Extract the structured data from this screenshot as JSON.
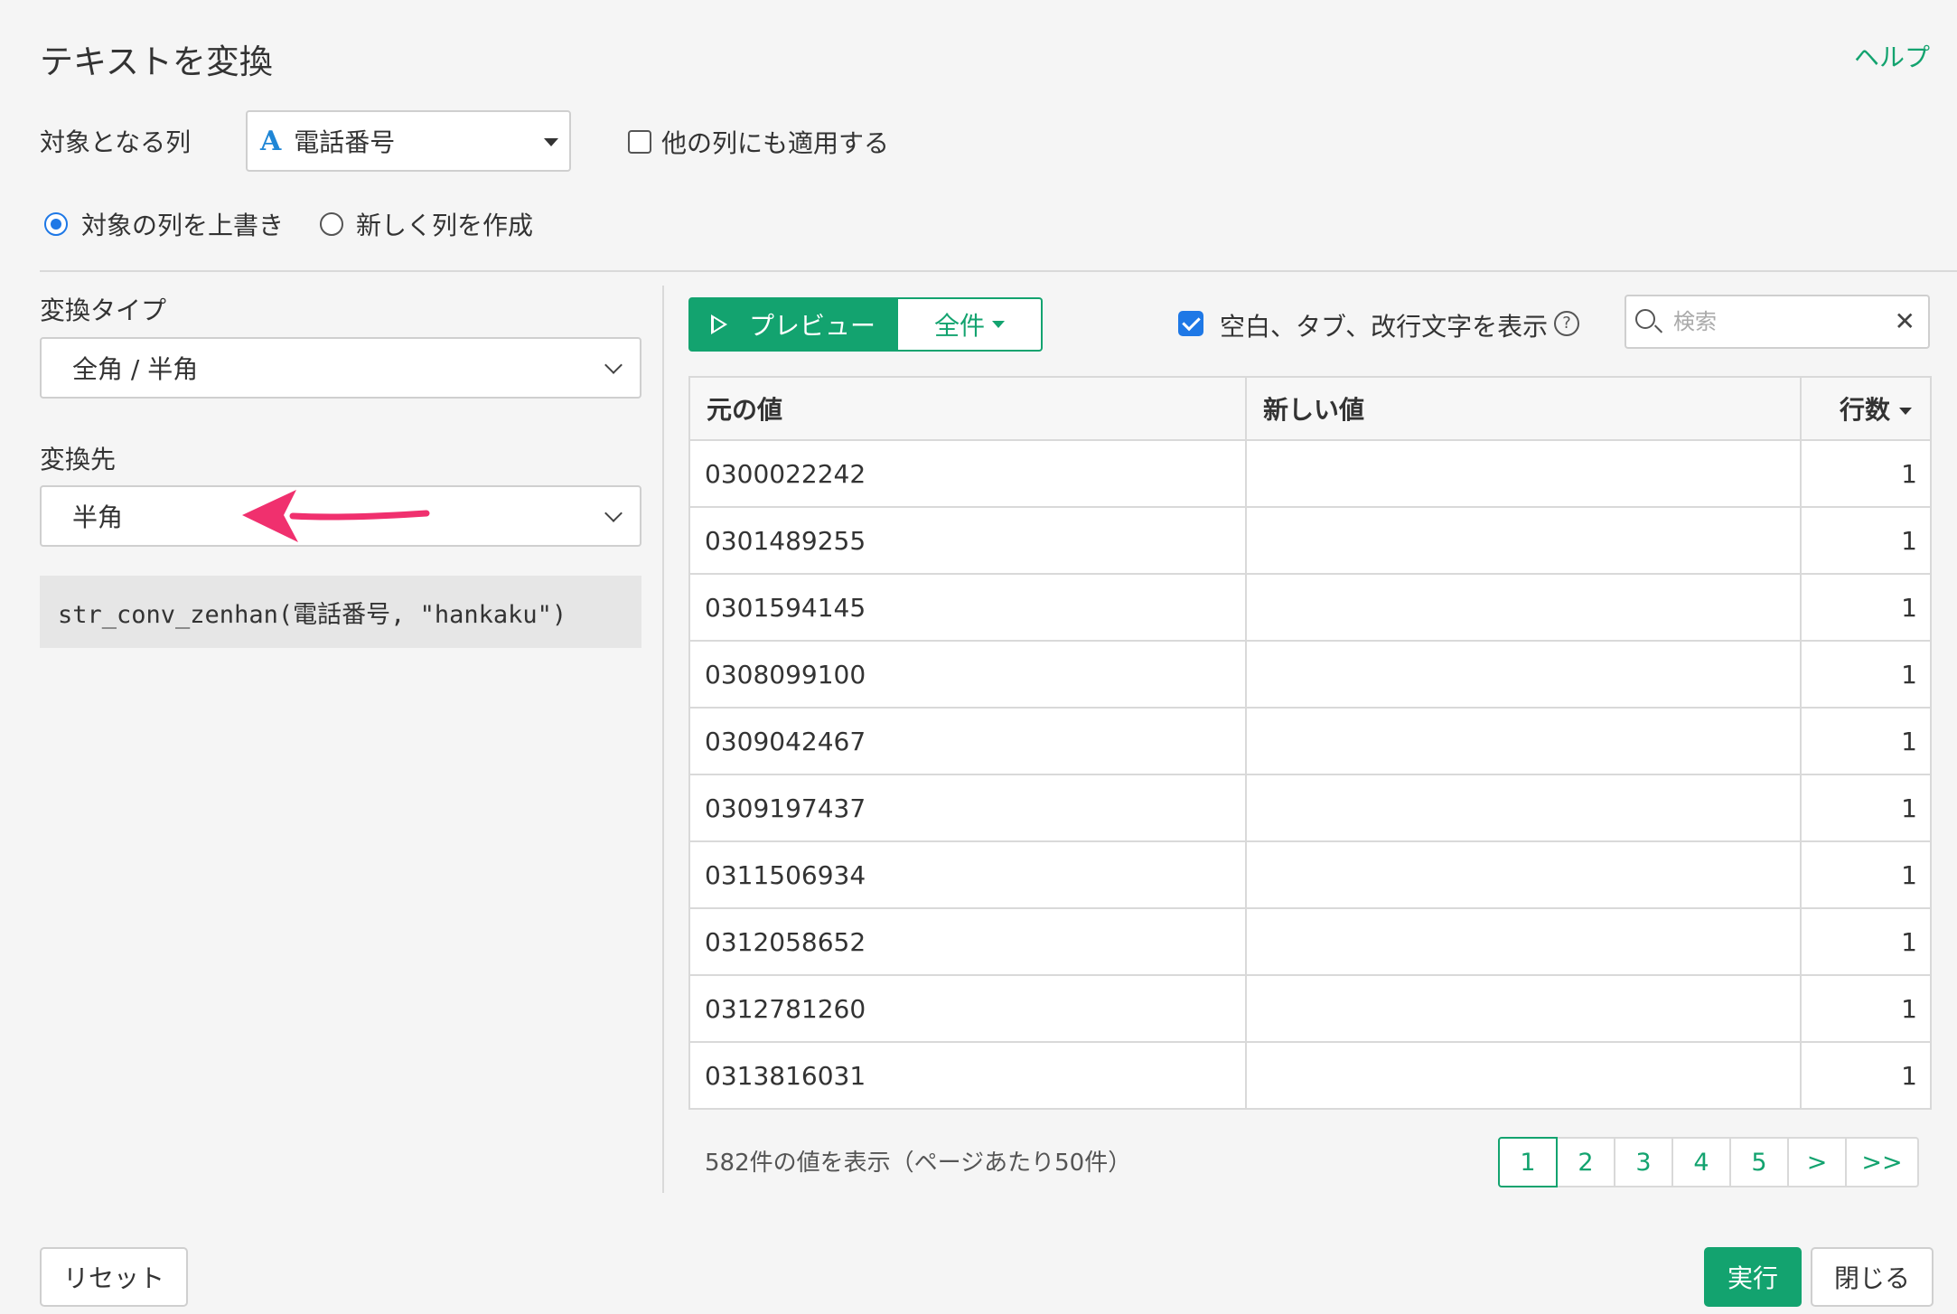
{
  "title": "テキストを変換",
  "help_label": "ヘルプ",
  "target_column": {
    "label": "対象となる列",
    "type_icon": "A",
    "value": "電話番号",
    "apply_other_label": "他の列にも適用する"
  },
  "output_mode": {
    "overwrite_label": "対象の列を上書き",
    "new_column_label": "新しく列を作成",
    "selected": "overwrite"
  },
  "conversion_type": {
    "label": "変換タイプ",
    "value": "全角 / 半角"
  },
  "conversion_target": {
    "label": "変換先",
    "value": "半角"
  },
  "code": "str_conv_zenhan(電話番号, \"hankaku\")",
  "preview": {
    "preview_label": "プレビュー",
    "all_label": "全件",
    "show_whitespace_label": "空白、タブ、改行文字を表示",
    "show_whitespace_checked": true,
    "help_icon": "?",
    "search_placeholder": "検索"
  },
  "table": {
    "headers": [
      "元の値",
      "新しい値",
      "行数"
    ],
    "rows": [
      {
        "original": "0300022242",
        "new": "",
        "count": "1"
      },
      {
        "original": "0301489255",
        "new": "",
        "count": "1"
      },
      {
        "original": "0301594145",
        "new": "",
        "count": "1"
      },
      {
        "original": "0308099100",
        "new": "",
        "count": "1"
      },
      {
        "original": "0309042467",
        "new": "",
        "count": "1"
      },
      {
        "original": "0309197437",
        "new": "",
        "count": "1"
      },
      {
        "original": "0311506934",
        "new": "",
        "count": "1"
      },
      {
        "original": "0312058652",
        "new": "",
        "count": "1"
      },
      {
        "original": "0312781260",
        "new": "",
        "count": "1"
      },
      {
        "original": "0313816031",
        "new": "",
        "count": "1"
      }
    ]
  },
  "page_info": "582件の値を表示（ページあたり50件）",
  "pagination": [
    "1",
    "2",
    "3",
    "4",
    "5",
    ">",
    ">>"
  ],
  "buttons": {
    "reset": "リセット",
    "run": "実行",
    "close": "閉じる"
  },
  "colors": {
    "accent": "#13a36f",
    "checkbox": "#1e78e6",
    "annotation_arrow": "#f0306e"
  }
}
